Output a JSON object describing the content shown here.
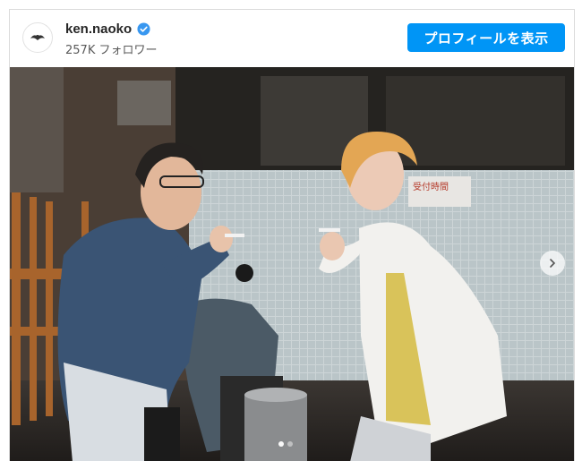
{
  "post": {
    "username": "ken.naoko",
    "verified_icon": "verified-badge-icon",
    "followers": "257K フォロワー",
    "profile_button": "プロフィールを表示",
    "accent_color": "#0095f6"
  },
  "photo": {
    "sign_text": "受付時間",
    "carousel": {
      "total": 2,
      "current": 1,
      "next_icon": "chevron-right-icon"
    }
  }
}
